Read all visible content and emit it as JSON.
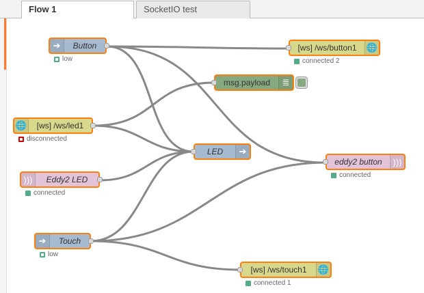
{
  "tabs": [
    {
      "label": "Flow 1",
      "active": true
    },
    {
      "label": "SocketIO test",
      "active": false
    }
  ],
  "nodes": {
    "button_in": {
      "label": "Button",
      "status": "low"
    },
    "ws_led1_in": {
      "label": "[ws] /ws/led1",
      "status": "disconnected"
    },
    "eddy2_led": {
      "label": "Eddy2 LED",
      "status": "connected"
    },
    "touch_in": {
      "label": "Touch",
      "status": "low"
    },
    "msg_payload": {
      "label": "msg.payload"
    },
    "led_out": {
      "label": "LED"
    },
    "ws_button1_out": {
      "label": "[ws] /ws/button1",
      "status": "connected 2"
    },
    "eddy2_button": {
      "label": "eddy2 button",
      "status": "connected"
    },
    "ws_touch1_out": {
      "label": "[ws] /ws/touch1",
      "status": "connected 1"
    }
  },
  "colors": {
    "accent": "#ff7f0e",
    "gpio": "#a6bbcf",
    "websocket": "#d8d88c",
    "eddystone": "#e2c3d8",
    "debug": "#87a980",
    "wire": "#888888"
  },
  "icons": {
    "gpio": "arrow-right-icon",
    "websocket": "web-icon",
    "eddystone": "radio-waves-icon",
    "debug": "debug-list-icon"
  }
}
